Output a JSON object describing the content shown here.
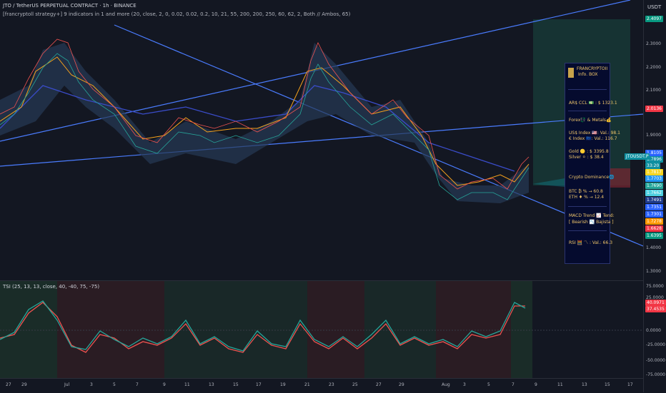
{
  "header": {
    "title": "JTO / TetherUS PERPETUAL CONTRACT · 1h · BINANCE",
    "indicator_line": "[francryptoll strategy+] 9 indicators in 1 and more (20, close, 2, 0, 0.02, 0.02, 0.2, 10, 21, 55, 200, 200, 250, 60, 62, 2, Both // Ambos, 65)"
  },
  "currency": "USDT",
  "price_ticks": [
    "2.3000",
    "2.2000",
    "2.1000",
    "1.9000",
    "1.4000",
    "1.3000"
  ],
  "price_tags": [
    {
      "label": "2.4097",
      "bg": "#089981"
    },
    {
      "label": "2.0136",
      "bg": "#f23645"
    },
    {
      "label": "1.8105",
      "bg": "#2962ff"
    },
    {
      "label": "1.7896",
      "bg": "#0e8fa0"
    },
    {
      "label": "33:20",
      "bg": "#0e8fa0"
    },
    {
      "label": "1.7817",
      "bg": "#f7d51f"
    },
    {
      "label": "1.7703",
      "bg": "#2196f3"
    },
    {
      "label": "1.7690",
      "bg": "#26a69a"
    },
    {
      "label": "1.7662",
      "bg": "#4dd0e1"
    },
    {
      "label": "1.7491",
      "bg": "#1e3a8a"
    },
    {
      "label": "1.7351",
      "bg": "#2962ff"
    },
    {
      "label": "1.7301",
      "bg": "#2962ff"
    },
    {
      "label": "1.7278",
      "bg": "#ff9800"
    },
    {
      "label": "1.6628",
      "bg": "#f23645"
    },
    {
      "label": "1.6395",
      "bg": "#089981"
    }
  ],
  "symbol_tag": "JTOUSDT.P",
  "tsi": {
    "label": "TSI (25, 13, 13, close, 40, -40, 75, -75)",
    "ticks": [
      "75.0000",
      "25.0000",
      "0.0000",
      "-25.0000",
      "-50.0000",
      "-75.0000"
    ],
    "value_tags": [
      {
        "label": "40.0971",
        "bg": "#f23645"
      },
      {
        "label": "37.4535",
        "bg": "#f23645"
      }
    ]
  },
  "dates": [
    "27",
    "29",
    "Jul",
    "3",
    "5",
    "7",
    "9",
    "11",
    "13",
    "15",
    "17",
    "19",
    "21",
    "23",
    "25",
    "27",
    "29",
    "Aug",
    "3",
    "5",
    "7",
    "9",
    "11",
    "13",
    "15",
    "17"
  ],
  "info_box": {
    "title": "FRANCRYPTOII",
    "subtitle": "Info. BOX",
    "ccl": "AR$ CCL 💵 :  $ 1323.1",
    "forex_header": "Forex💱 & Metals💰",
    "usd_index": "US$ Index 🇺🇸: Val.: 98.1",
    "eur_index": "€ Index 🇪🇺: Val.: 116.7",
    "gold": "Gold 🟡 : $ 3395.8",
    "silver": "Silver ⚪ : $ 38.4",
    "crypto_header": "Crypto Dominance🌐",
    "btc": "BTC ₿ % → 60.8",
    "eth": "ETH ♦ % → 12.4",
    "macd": "MACD Trend 📈 Tend:",
    "macd_val": "[ Bearish 📉 Bajista ]",
    "rsi": "RSI 🧮 〽 : Val.: 66.3"
  },
  "colors": {
    "bg": "#131722",
    "up": "#26a69a",
    "down": "#f23645",
    "trend": "#4a7cff"
  }
}
